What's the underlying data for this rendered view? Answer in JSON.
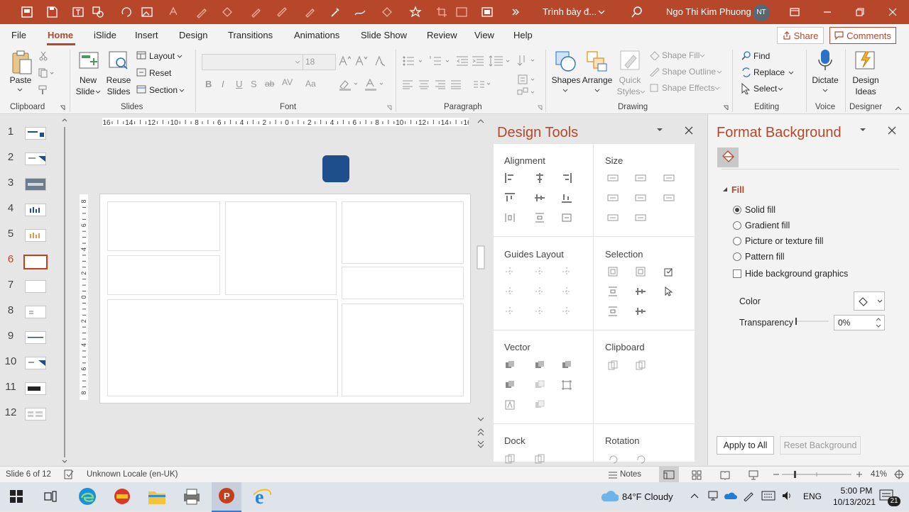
{
  "window": {
    "doc_title": "Trình bày đ...",
    "user_name": "Ngo Thi Kim Phuong",
    "user_initials": "NT"
  },
  "tabs": [
    "File",
    "Home",
    "iSlide",
    "Insert",
    "Design",
    "Transitions",
    "Animations",
    "Slide Show",
    "Review",
    "View",
    "Help"
  ],
  "share_label": "Share",
  "comments_label": "Comments",
  "ribbon": {
    "clipboard": {
      "paste": "Paste",
      "group": "Clipboard"
    },
    "slides": {
      "new_slide_1": "New",
      "new_slide_2": "Slide",
      "reuse_1": "Reuse",
      "reuse_2": "Slides",
      "layout": "Layout",
      "reset": "Reset",
      "section": "Section",
      "group": "Slides"
    },
    "font": {
      "size": "18",
      "group": "Font"
    },
    "paragraph": {
      "group": "Paragraph"
    },
    "drawing": {
      "shapes": "Shapes",
      "arrange": "Arrange",
      "quick_1": "Quick",
      "quick_2": "Styles",
      "shape_fill": "Shape Fill",
      "shape_outline": "Shape Outline",
      "shape_effects": "Shape Effects",
      "group": "Drawing"
    },
    "editing": {
      "find": "Find",
      "replace": "Replace",
      "select": "Select",
      "group": "Editing"
    },
    "voice": {
      "dictate": "Dictate",
      "group": "Voice"
    },
    "designer": {
      "ideas_1": "Design",
      "ideas_2": "Ideas",
      "group": "Designer"
    }
  },
  "thumbnails": [
    "1",
    "2",
    "3",
    "4",
    "5",
    "6",
    "7",
    "8",
    "9",
    "10",
    "11",
    "12"
  ],
  "active_slide": 6,
  "ruler_h": [
    "16",
    "14",
    "12",
    "10",
    "8",
    "6",
    "4",
    "2",
    "0",
    "2",
    "4",
    "6",
    "8",
    "10",
    "12",
    "14",
    "16"
  ],
  "ruler_v": [
    "8",
    "6",
    "4",
    "2",
    "0",
    "2",
    "4",
    "6",
    "8"
  ],
  "design_tools": {
    "title": "Design Tools",
    "sections": {
      "alignment": "Alignment",
      "size": "Size",
      "guides": "Guides Layout",
      "selection": "Selection",
      "vector": "Vector",
      "clipboard": "Clipboard",
      "dock": "Dock",
      "rotation": "Rotation"
    }
  },
  "format_background": {
    "title": "Format Background",
    "fill_header": "Fill",
    "options": [
      "Solid fill",
      "Gradient fill",
      "Picture or texture fill",
      "Pattern fill"
    ],
    "selected_option": "Solid fill",
    "hide_graphics": "Hide background graphics",
    "color_label": "Color",
    "transparency_label": "Transparency",
    "transparency_value": "0%",
    "apply_all": "Apply to All",
    "reset_bg": "Reset Background"
  },
  "status": {
    "slide_info": "Slide 6 of 12",
    "locale": "Unknown Locale (en-UK)",
    "notes": "Notes",
    "zoom": "41%"
  },
  "taskbar": {
    "weather": "84°F  Cloudy",
    "lang": "ENG",
    "time": "5:00 PM",
    "date": "10/13/2021",
    "notif_count": "21"
  },
  "colors": {
    "accent": "#b7472a",
    "shape_blue": "#1e4e8c"
  }
}
